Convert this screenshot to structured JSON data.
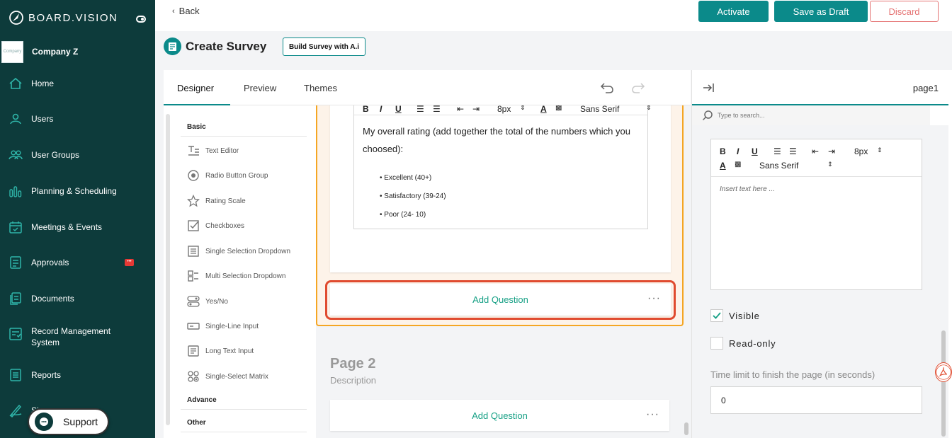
{
  "brand": {
    "name": "BOARD.VISION"
  },
  "company": {
    "name": "Company Z",
    "logo_text": "Company"
  },
  "sidebar": {
    "items": [
      {
        "label": "Home",
        "icon": "home-icon"
      },
      {
        "label": "Users",
        "icon": "user-icon"
      },
      {
        "label": "User Groups",
        "icon": "users-icon"
      },
      {
        "label": "Planning & Scheduling",
        "icon": "chart-icon"
      },
      {
        "label": "Meetings & Events",
        "icon": "calendar-icon"
      },
      {
        "label": "Approvals",
        "icon": "approval-icon"
      },
      {
        "label": "Documents",
        "icon": "documents-icon"
      },
      {
        "label": "Record Management System",
        "icon": "records-icon"
      },
      {
        "label": "Reports",
        "icon": "report-icon"
      },
      {
        "label": "Sig",
        "icon": "signature-icon"
      }
    ],
    "approvals_badge": "•••"
  },
  "support": {
    "label": "Support"
  },
  "topbar": {
    "back_label": "Back",
    "activate_label": "Activate",
    "save_draft_label": "Save as Draft",
    "discard_label": "Discard"
  },
  "header": {
    "title": "Create Survey",
    "ai_button": "Build Survey with A.i"
  },
  "tabs": [
    {
      "label": "Designer",
      "active": true
    },
    {
      "label": "Preview",
      "active": false
    },
    {
      "label": "Themes",
      "active": false
    }
  ],
  "toolbox": {
    "sections": {
      "basic": "Basic",
      "advance": "Advance",
      "other": "Other"
    },
    "items": [
      {
        "label": "Text Editor",
        "icon": "text-editor-icon"
      },
      {
        "label": "Radio Button Group",
        "icon": "radio-icon"
      },
      {
        "label": "Rating Scale",
        "icon": "star-icon"
      },
      {
        "label": "Checkboxes",
        "icon": "checkbox-icon"
      },
      {
        "label": "Single Selection Dropdown",
        "icon": "dropdown-icon"
      },
      {
        "label": "Multi Selection Dropdown",
        "icon": "multi-dropdown-icon"
      },
      {
        "label": "Yes/No",
        "icon": "toggle-icon"
      },
      {
        "label": "Single-Line Input",
        "icon": "input-icon"
      },
      {
        "label": "Long Text Input",
        "icon": "textarea-icon"
      },
      {
        "label": "Single-Select Matrix",
        "icon": "matrix-icon"
      }
    ]
  },
  "editor": {
    "font_size": "8px",
    "font_family": "Sans Serif",
    "body_text": "My overall rating (add together the total of the numbers which you choosed):",
    "list": [
      "• Excellent (40+)",
      "• Satisfactory (39-24)",
      "• Poor (24- 10)"
    ]
  },
  "canvas": {
    "add_question": "Add Question",
    "more": "···",
    "page2_title": "Page 2",
    "page2_desc": "Description"
  },
  "properties": {
    "page_name": "page1",
    "search_placeholder": "Type to search...",
    "font_size": "8px",
    "font_family": "Sans Serif",
    "rte_placeholder": "Insert text here ...",
    "visible_label": "Visible",
    "visible_checked": true,
    "readonly_label": "Read-only",
    "readonly_checked": false,
    "time_limit_label": "Time limit to finish the page (in seconds)",
    "time_limit_value": "0"
  },
  "colors": {
    "sidebar_bg": "#0d3b3b",
    "accent": "#0b8a8a",
    "add_question": "#16a085",
    "discard": "#e57373",
    "selected_page_border": "#f5a623",
    "highlight_outline": "#e04b2f"
  }
}
